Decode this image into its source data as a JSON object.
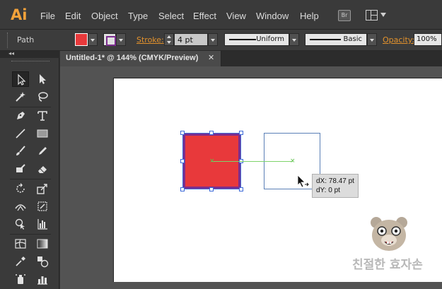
{
  "app": {
    "logo": "Ai"
  },
  "menu": [
    "File",
    "Edit",
    "Object",
    "Type",
    "Select",
    "Effect",
    "View",
    "Window",
    "Help"
  ],
  "bridge_button": "Br",
  "control": {
    "selection_type": "Path",
    "fill_color": "#e8393b",
    "stroke_color": "#7b2d8e",
    "stroke_label": "Stroke:",
    "stroke_weight": "4 pt",
    "variable_width_profile": "Uniform",
    "brush_definition": "Basic",
    "opacity_label": "Opacity:",
    "opacity_value": "100%"
  },
  "tools_panel": {
    "collapse_glyph": "◂◂"
  },
  "document": {
    "tab_title": "Untitled-1* @ 144% (CMYK/Preview)",
    "close_glyph": "✕"
  },
  "canvas": {
    "tooltip_dx": "dX: 78.47 pt",
    "tooltip_dy": "dY: 0 pt"
  },
  "watermark": {
    "text": "친절한 효자손"
  },
  "colors": {
    "accent": "#e3922c",
    "selection": "#3c6ad8",
    "smart_guide": "#7ed36b"
  }
}
